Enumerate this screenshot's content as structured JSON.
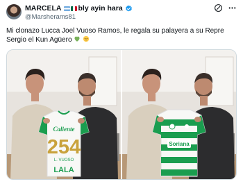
{
  "author": {
    "display_name": "MARCELA",
    "display_name_suffix": "bly ayin hara",
    "handle": "@Marsherams81",
    "avatar": "profile-photo",
    "flags": [
      "argentina-flag",
      "mexico-flag"
    ]
  },
  "tweet": {
    "line1": "Mi clonazo Lucca Joel Vuoso Ramos, le regala su palayera a su Repre",
    "line2": "Sergio el Kun Agüero"
  },
  "icons": {
    "verified": "verified-badge-icon",
    "grok": "grok-icon",
    "more": "more-icon",
    "heart": "green-heart-emoji",
    "face": "relieved-face-emoji"
  },
  "jersey": {
    "sponsor": "Caliente",
    "number": "254",
    "name": "L. VUOSO",
    "bottom_sponsor": "LALA",
    "front_sponsor": "Soriana"
  },
  "colors": {
    "verified": "#1d9bf0",
    "text": "#0f1419",
    "secondary": "#536471",
    "jersey_green": "#1a9d4f",
    "number_gold": "#c9a23c"
  }
}
